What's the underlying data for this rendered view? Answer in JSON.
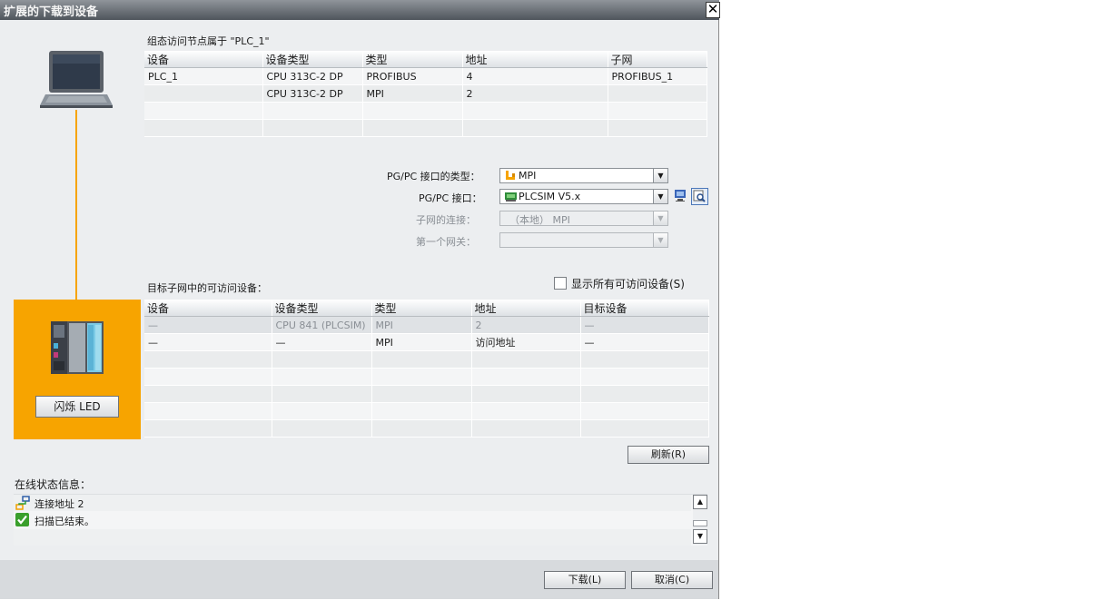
{
  "window": {
    "title": "扩展的下载到设备",
    "close_glyph": "✕"
  },
  "configured": {
    "heading": "组态访问节点属于 \"PLC_1\"",
    "columns": [
      "设备",
      "设备类型",
      "类型",
      "地址",
      "子网"
    ],
    "rows": [
      [
        "PLC_1",
        "CPU 313C-2 DP",
        "PROFIBUS",
        "4",
        "PROFIBUS_1"
      ],
      [
        "",
        "CPU 313C-2 DP",
        "MPI",
        "2",
        ""
      ],
      [
        "",
        "",
        "",
        "",
        ""
      ],
      [
        "",
        "",
        "",
        "",
        ""
      ]
    ]
  },
  "interface": {
    "type_label": "PG/PC 接口的类型：",
    "type_value": "MPI",
    "iface_label": "PG/PC 接口：",
    "iface_value": "PLCSIM V5.x",
    "subnet_label": "子网的连接：",
    "subnet_value": "（本地） MPI",
    "gateway_label": "第一个网关：",
    "gateway_value": ""
  },
  "target": {
    "heading": "目标子网中的可访问设备：",
    "show_all_label": "显示所有可访问设备(S)",
    "show_all_checked": false,
    "columns": [
      "设备",
      "设备类型",
      "类型",
      "地址",
      "目标设备"
    ],
    "rows": [
      [
        "—",
        "CPU 841 (PLCSIM)",
        "MPI",
        "2",
        "—"
      ],
      [
        "—",
        "—",
        "MPI",
        "访问地址",
        "—"
      ],
      [
        "",
        "",
        "",
        "",
        ""
      ],
      [
        "",
        "",
        "",
        "",
        ""
      ],
      [
        "",
        "",
        "",
        "",
        ""
      ],
      [
        "",
        "",
        "",
        "",
        ""
      ],
      [
        "",
        "",
        "",
        "",
        ""
      ]
    ]
  },
  "buttons": {
    "flash_led": "闪烁 LED",
    "refresh": "刷新(R)",
    "download": "下载(L)",
    "cancel": "取消(C)"
  },
  "status": {
    "heading": "在线状态信息：",
    "messages": [
      {
        "icon": "network-connect-icon",
        "text": "连接地址 2"
      },
      {
        "icon": "green-check-icon",
        "text": "扫描已结束。"
      }
    ]
  },
  "colors": {
    "accent": "#f7a400",
    "link_line": "#f7a400",
    "titlebar": "#5c6168",
    "check_green": "#3a9f2c"
  }
}
